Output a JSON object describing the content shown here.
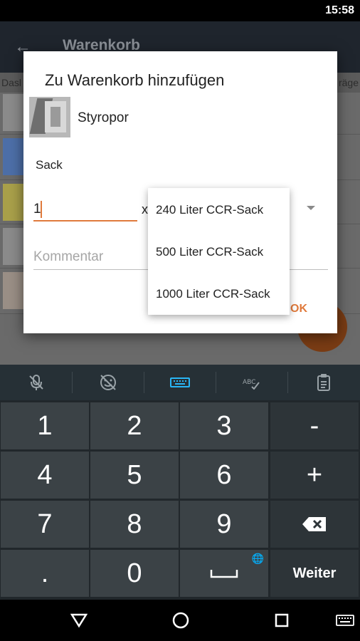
{
  "status": {
    "time": "15:58"
  },
  "appbar": {
    "title": "Warenkorb",
    "back_icon": "arrow-left"
  },
  "list_header": {
    "left": "Dasl",
    "right": "räge"
  },
  "dialog": {
    "title": "Zu Warenkorb hinzufügen",
    "product_name": "Styropor",
    "unit_label": "Sack",
    "quantity_value": "1",
    "times_symbol": "x",
    "comment_placeholder": "Kommentar",
    "ok_label": "OK"
  },
  "dropdown": {
    "options": [
      "240 Liter CCR-Sack",
      "500 Liter CCR-Sack",
      "1000 Liter CCR-Sack"
    ]
  },
  "keyboard": {
    "toolbar": [
      "mic-off-icon",
      "emoji-off-icon",
      "keyboard-icon",
      "spellcheck-icon",
      "clipboard-icon"
    ],
    "accent_color": "#29b6f6",
    "keys": {
      "k1": "1",
      "k2": "2",
      "k3": "3",
      "minus": "-",
      "k4": "4",
      "k5": "5",
      "k6": "6",
      "plus": "+",
      "k7": "7",
      "k8": "8",
      "k9": "9",
      "dot": ".",
      "k0": "0",
      "next": "Weiter"
    }
  },
  "colors": {
    "accent": "#e07a3c"
  }
}
